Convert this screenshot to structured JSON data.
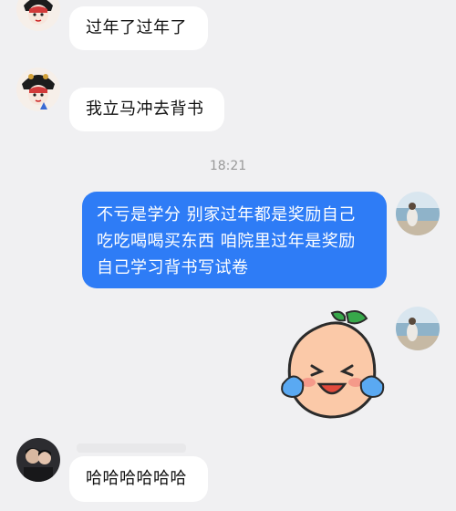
{
  "messages": [
    {
      "side": "in",
      "text": "过年了过年了"
    },
    {
      "side": "in",
      "text": "我立马冲去背书"
    },
    {
      "side": "out",
      "lines": [
        "不亏是学分 别家过年都是奖励自己",
        "吃吃喝喝买东西 咱院里过年是奖励",
        "自己学习背书写试卷"
      ]
    },
    {
      "side": "out",
      "sticker": "crying-laughing-peach-sticker"
    },
    {
      "side": "in",
      "text": "哈哈哈哈哈哈"
    }
  ],
  "timestamp": "18:21",
  "colors": {
    "outgoing_bubble": "#2e7cf6",
    "incoming_bubble": "#ffffff",
    "background": "#f0f0f2"
  }
}
